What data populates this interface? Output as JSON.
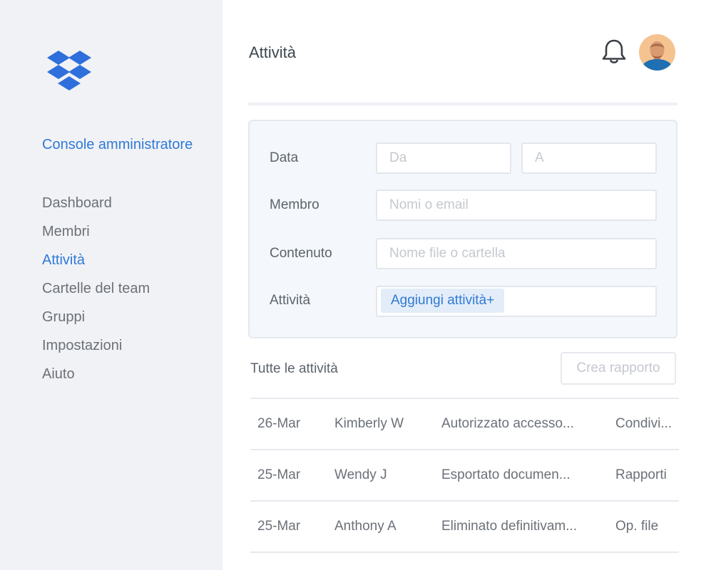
{
  "sidebar": {
    "logo_icon": "dropbox-logo",
    "console_title": "Console amministratore",
    "items": [
      {
        "label": "Dashboard",
        "active": false
      },
      {
        "label": "Membri",
        "active": false
      },
      {
        "label": "Attività",
        "active": true
      },
      {
        "label": "Cartelle del team",
        "active": false
      },
      {
        "label": "Gruppi",
        "active": false
      },
      {
        "label": "Impostazioni",
        "active": false
      },
      {
        "label": "Aiuto",
        "active": false
      }
    ]
  },
  "header": {
    "title": "Attività",
    "bell_icon": "bell-icon",
    "avatar_icon": "user-avatar"
  },
  "filters": {
    "date_label": "Data",
    "date_from_placeholder": "Da",
    "date_to_placeholder": "A",
    "member_label": "Membro",
    "member_placeholder": "Nomi o email",
    "content_label": "Contenuto",
    "content_placeholder": "Nome file o cartella",
    "activity_label": "Attività",
    "add_activity_label": "Aggiungi attività+"
  },
  "activity_list": {
    "title": "Tutte le attività",
    "report_button": "Crea rapporto",
    "rows": [
      {
        "date": "26-Mar",
        "member": "Kimberly W",
        "activity": "Autorizzato accesso...",
        "category": "Condivi..."
      },
      {
        "date": "25-Mar",
        "member": "Wendy J",
        "activity": "Esportato documen...",
        "category": "Rapporti"
      },
      {
        "date": "25-Mar",
        "member": "Anthony A",
        "activity": "Eliminato definitivam...",
        "category": "Op. file"
      }
    ]
  },
  "colors": {
    "accent": "#2f7ad6",
    "sidebar_bg": "#f1f2f6",
    "panel_bg": "#f4f7fb"
  }
}
